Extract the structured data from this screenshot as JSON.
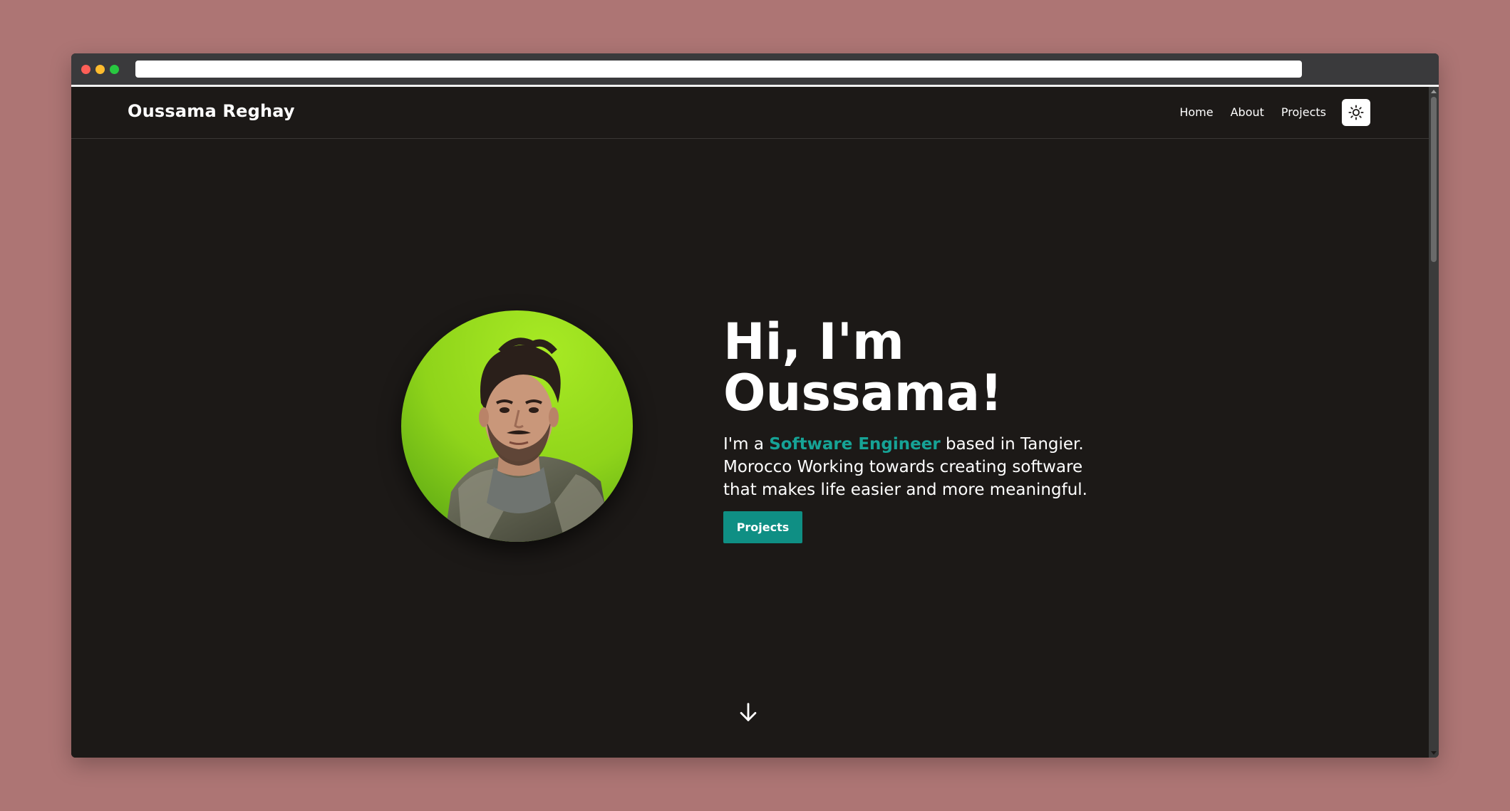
{
  "nav": {
    "brand": "Oussama Reghay",
    "links": [
      "Home",
      "About",
      "Projects"
    ],
    "theme_icon": "sun-icon"
  },
  "hero": {
    "title_line1": "Hi, I'm",
    "title_line2": "Oussama!",
    "subtitle_prefix": "I'm a ",
    "subtitle_accent": "Software Engineer",
    "subtitle_rest": " based in Tangier. Morocco Working towards creating software that makes life easier and more meaningful.",
    "cta_label": "Projects",
    "scroll_icon": "arrow-down-icon"
  },
  "colors": {
    "page_bg": "#1c1917",
    "accent": "#16a396",
    "button": "#0f8f84",
    "desktop_bg": "#ad7574"
  }
}
